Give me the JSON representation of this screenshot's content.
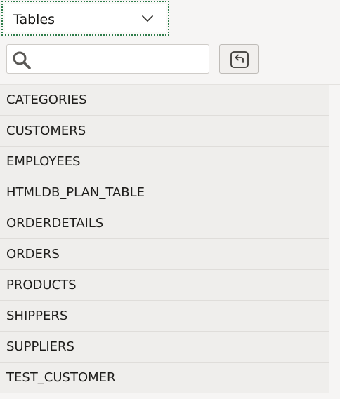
{
  "object_type_select": {
    "selected": "Tables"
  },
  "search": {
    "value": "",
    "placeholder": ""
  },
  "tables": [
    "CATEGORIES",
    "CUSTOMERS",
    "EMPLOYEES",
    "HTMLDB_PLAN_TABLE",
    "ORDERDETAILS",
    "ORDERS",
    "PRODUCTS",
    "SHIPPERS",
    "SUPPLIERS",
    "TEST_CUSTOMER"
  ],
  "icons": {
    "select_arrow": "chevron-down-icon",
    "search": "search-icon",
    "back": "back-arrow-icon"
  },
  "colors": {
    "focus_ring": "#2e7d4a",
    "background": "#f6f5f4",
    "list_background": "#efeeec"
  }
}
